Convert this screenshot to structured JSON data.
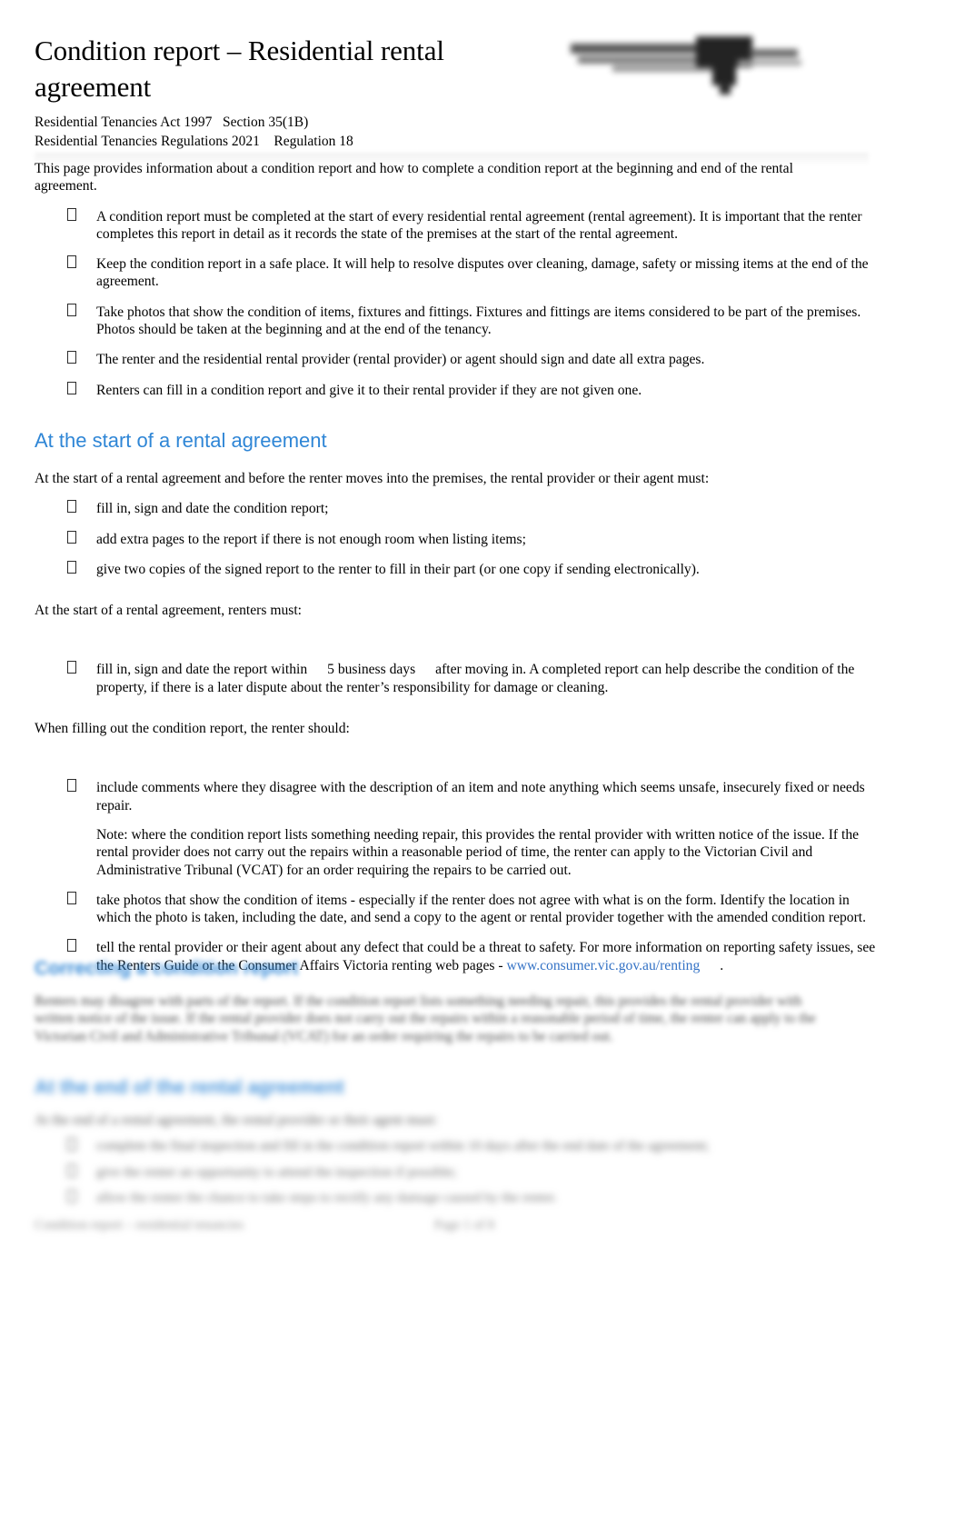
{
  "document": {
    "title": "Condition report – Residential rental agreement",
    "act_line_1": "Residential Tenancies Act 1997   Section 35(1B)",
    "act_line_2": "Residential Tenancies Regulations 2021    Regulation 18",
    "logo_alt": "victoria-state-government-logo",
    "accent_heading_color": "#2f86d6",
    "link_color": "#2f6fc4"
  },
  "intro": {
    "paragraph": "This page provides information about a condition report and how to complete a condition report at the beginning and end of the rental agreement."
  },
  "intro_bullets": [
    {
      "text": "A condition report must be completed at the start of every residential rental agreement (rental agreement). It is important that the renter completes this report in detail as it records the state of the premises at the start of the rental agreement."
    },
    {
      "text": "Keep the condition report in a safe place. It will help to resolve disputes over cleaning, damage, safety or missing items at the end of the agreement."
    },
    {
      "text": "Take photos that show the condition of items, fixtures and fittings. Fixtures and fittings are items considered to be part of the premises. Photos should be taken at the beginning and at the end of the tenancy."
    },
    {
      "text": "The renter and the residential rental provider (rental provider) or agent should sign and date all extra pages."
    },
    {
      "text": "Renters can fill in a condition report and give it to their rental provider if they are not given one."
    }
  ],
  "section_start": {
    "heading": "At the start of a rental agreement",
    "lead_provider": "At the start of a rental agreement and before the renter moves into the premises, the rental provider or their agent must:",
    "provider_bullets": [
      {
        "text": "fill in, sign and date the condition report;"
      },
      {
        "text": "add extra pages to the report if there is not enough room when listing items;"
      },
      {
        "text": "give two copies of the signed report to the renter to fill in their part (or one copy if sending electronically)."
      }
    ],
    "lead_renters": "At the start of a rental agreement, renters must:",
    "renter_bullet_part1": "fill in, sign and date the report within",
    "renter_bullet_field": "5 business days",
    "renter_bullet_part2": "after moving in. A completed report can help describe the condition of the property, if there is a later dispute about the renter’s responsibility for damage or cleaning.",
    "lead_filling": "When filling out the condition report, the renter should:",
    "filling_bullets": [
      {
        "text": "include comments where they disagree with the description of an item and note anything which seems unsafe, insecurely fixed or needs repair."
      },
      {
        "text": "take photos that show the condition of items - especially if the renter does not agree with what is on the form. Identify the location in which the photo is taken, including the date, and send a copy to the agent or rental provider together with the amended condition report."
      }
    ],
    "note": "Note:   where the condition report lists something needing repair, this provides the rental provider with written notice of the issue. If the rental provider does not carry out the repairs within a reasonable period of time, the renter can apply to the Victorian Civil and Administrative Tribunal (VCAT) for an order requiring the repairs to be carried out.",
    "safety_bullet_part1": "tell the rental provider or their agent about any defect that could be a threat to safety. For more information on reporting safety issues, see the Renters Guide or the Consumer Affairs Victoria renting web pages -",
    "safety_link": "www.consumer.vic.gov.au/renting",
    "safety_bullet_tail": "."
  },
  "blurred_sections": [
    {
      "heading": "Correcting a condition report",
      "paragraph": "Renters may disagree with parts of the report. If the condition report lists something needing repair, this provides the rental provider with written notice of the issue. If the rental provider does not carry out the repairs within a reasonable period of time, the renter can apply to the Victorian Civil and Administrative Tribunal (VCAT) for an order requiring the repairs to be carried out."
    },
    {
      "heading": "At the end of the rental agreement",
      "lead": "At the end of a rental agreement, the rental provider or their agent must:",
      "bullets": [
        {
          "text": "complete the final inspection and fill in the condition report within 10 days after the end date of the agreement;"
        },
        {
          "text": "give the renter an opportunity to attend the inspection if possible;"
        },
        {
          "text": "allow the renter the chance to take steps to rectify any damage caused by the renter."
        }
      ]
    }
  ],
  "footer": {
    "left": "Condition report – residential tenancies",
    "center": "Page 1 of 8"
  }
}
